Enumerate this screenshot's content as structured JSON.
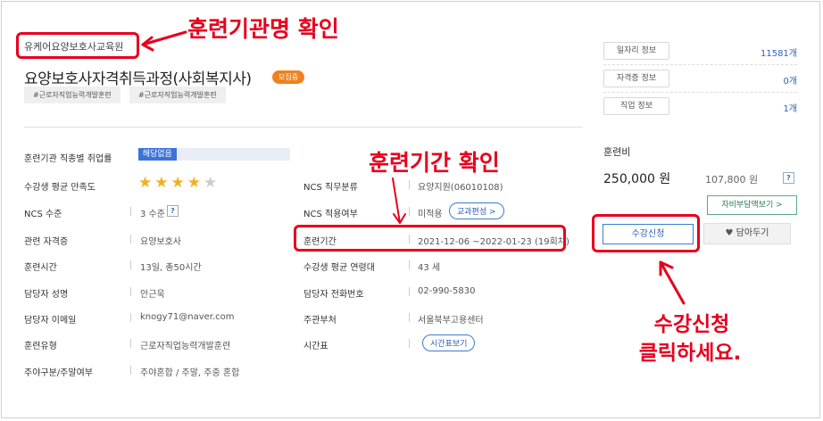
{
  "institution_name": "유케어요양보호사교육원",
  "course_title": "요양보호사자격취득과정(사회복지사)",
  "status_badge": "모집중",
  "tags": [
    "#근로자직업능력개발훈련",
    "#근로자직업능력개발훈련"
  ],
  "info_left": [
    {
      "label": "훈련기관 직종별 취업률",
      "value": "해당없음",
      "employment_bar_fill": 0.25
    },
    {
      "label": "수강생 평균 만족도",
      "value": "",
      "rating": 4,
      "rating_max": 5
    },
    {
      "label": "NCS 수준",
      "value": "3 수준",
      "help": "?"
    },
    {
      "label": "관련 자격증",
      "value": "요양보호사"
    },
    {
      "label": "훈련시간",
      "value": "13일, 총50시간"
    },
    {
      "label": "담당자 성명",
      "value": "안근욱"
    },
    {
      "label": "담당자 이메일",
      "value": "knogy71@naver.com"
    },
    {
      "label": "훈련유형",
      "value": "근로자직업능력개발훈련"
    },
    {
      "label": "주야구분/주말여부",
      "value": "주야혼합 / 주말, 주중 혼합"
    }
  ],
  "info_right": [
    {
      "label": "NCS 직무분류",
      "value": "요양지원(06010108)"
    },
    {
      "label": "NCS 적용여부",
      "value": "미적용",
      "button": "교과편성 >"
    },
    {
      "label": "훈련기간",
      "value": "2021-12-06 ~2022-01-23 (19회차)"
    },
    {
      "label": "수강생 평균 연령대",
      "value": "43 세"
    },
    {
      "label": "담당자 전화번호",
      "value": "02-990-5830"
    },
    {
      "label": "주관부처",
      "value": "서울북부고용센터"
    },
    {
      "label": "시간표",
      "value": "",
      "button": "시간표보기"
    }
  ],
  "side_links": [
    {
      "label": "일자리 정보",
      "value": "11581개"
    },
    {
      "label": "자격증 정보",
      "value": "0개"
    },
    {
      "label": "직업 정보",
      "value": "1개"
    }
  ],
  "fee": {
    "label": "훈련비",
    "price": "250,000 원",
    "self_pay": "107,800 원",
    "help": "?",
    "self_pay_button": "자비부담액보기 >"
  },
  "buttons": {
    "apply": "수강신청",
    "wishlist": "담아두기"
  },
  "annotations": {
    "institution": "훈련기관명 확인",
    "period": "훈련기간 확인",
    "apply_line1": "수강신청",
    "apply_line2": "클릭하세요."
  },
  "colors": {
    "annotation_red": "#e6001e",
    "accent_blue": "#3b73d9",
    "badge_orange": "#f0821e",
    "star_gold": "#f2b01e",
    "star_gray": "#cccccc"
  }
}
